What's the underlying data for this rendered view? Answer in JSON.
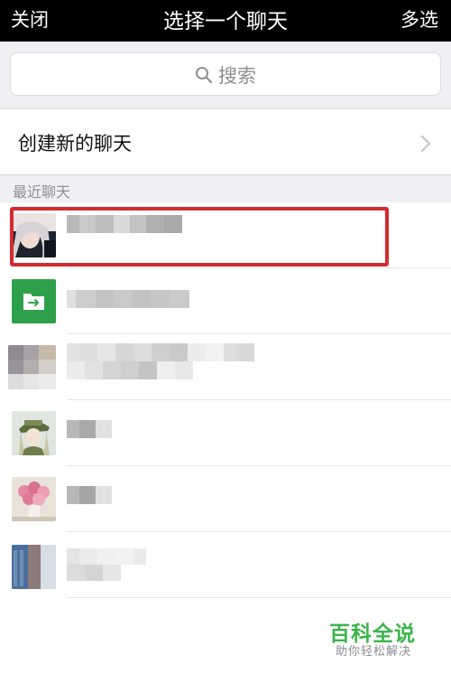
{
  "nav": {
    "close": "关闭",
    "title": "选择一个聊天",
    "multi_select": "多选"
  },
  "search": {
    "placeholder": "搜索"
  },
  "create_chat": {
    "label": "创建新的聊天"
  },
  "recent": {
    "header": "最近聊天"
  },
  "chats": [
    {
      "name": "",
      "avatar": "portrait-avatar",
      "highlighted": true
    },
    {
      "name": "",
      "avatar": "file-transfer-avatar",
      "highlighted": false
    },
    {
      "name": "",
      "avatar": "group-avatar",
      "highlighted": false
    },
    {
      "name": "",
      "avatar": "anime-avatar",
      "highlighted": false
    },
    {
      "name": "",
      "avatar": "flowers-avatar",
      "highlighted": false
    },
    {
      "name": "",
      "avatar": "building-avatar",
      "highlighted": false
    }
  ],
  "watermark": {
    "brand": "百科全说",
    "tagline": "助你轻松解决"
  },
  "colors": {
    "nav_bg": "#000000",
    "highlight": "#d42a30",
    "file_transfer": "#2ea04a",
    "brand_green": "#3bb54a"
  }
}
